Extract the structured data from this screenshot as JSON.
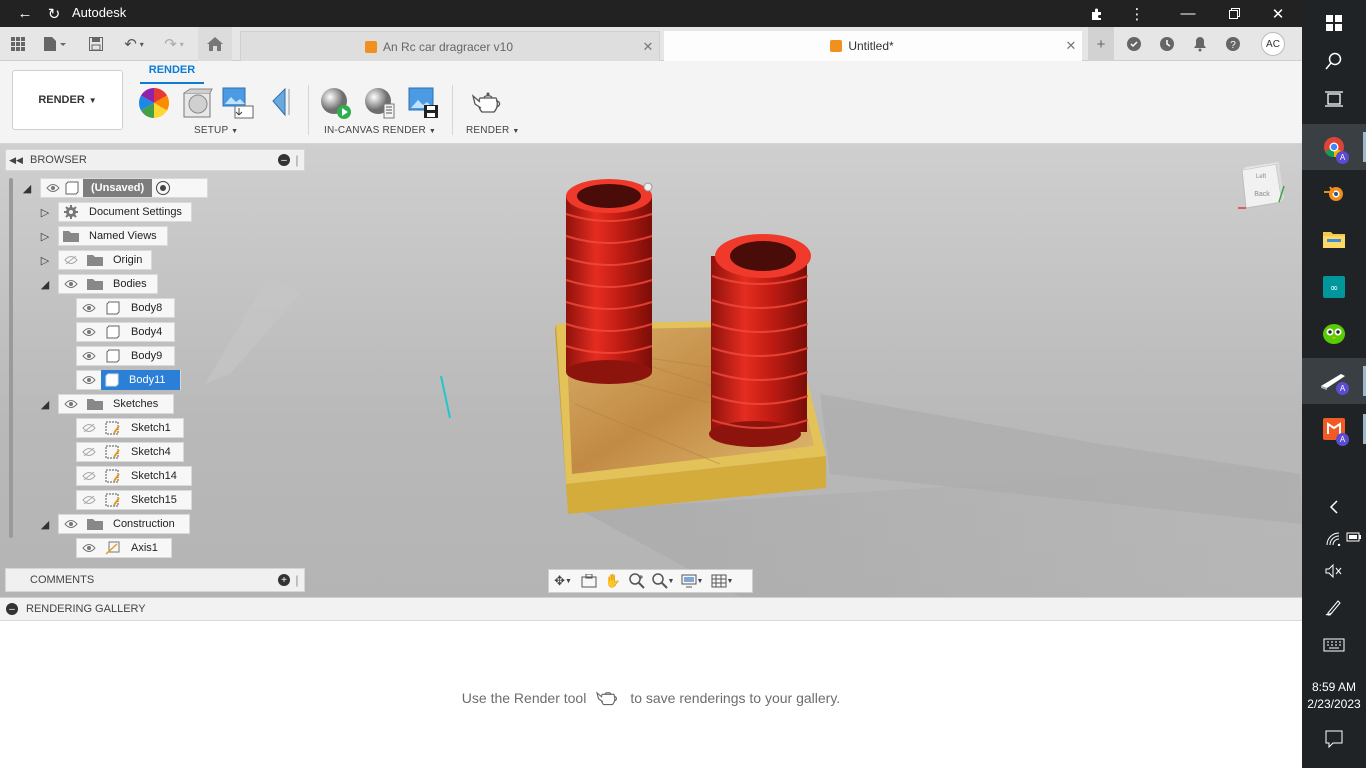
{
  "window": {
    "title": "Autodesk"
  },
  "tabs": [
    {
      "label": "An Rc car dragracer v10",
      "active": false
    },
    {
      "label": "Untitled*",
      "active": true
    }
  ],
  "user": {
    "initials": "AC"
  },
  "toolbar": {
    "workspace": "RENDER",
    "active_tab": "RENDER",
    "groups": [
      {
        "label": "SETUP"
      },
      {
        "label": "IN-CANVAS RENDER"
      },
      {
        "label": "RENDER"
      }
    ]
  },
  "browser": {
    "title": "BROWSER",
    "items": [
      {
        "label": "(Unsaved)"
      },
      {
        "label": "Document Settings"
      },
      {
        "label": "Named Views"
      },
      {
        "label": "Origin"
      },
      {
        "label": "Bodies"
      },
      {
        "label": "Body8"
      },
      {
        "label": "Body4"
      },
      {
        "label": "Body9"
      },
      {
        "label": "Body11"
      },
      {
        "label": "Sketches"
      },
      {
        "label": "Sketch1"
      },
      {
        "label": "Sketch4"
      },
      {
        "label": "Sketch14"
      },
      {
        "label": "Sketch15"
      },
      {
        "label": "Construction"
      },
      {
        "label": "Axis1"
      }
    ]
  },
  "comments": {
    "title": "COMMENTS"
  },
  "viewcube": {
    "faces": [
      "Left",
      "Back"
    ]
  },
  "gallery": {
    "title": "RENDERING GALLERY",
    "message_prefix": "Use the Render tool",
    "message_suffix": "to save renderings to your gallery."
  },
  "taskbar": {
    "time": "8:59 AM",
    "date": "2/23/2023",
    "badge": "A"
  },
  "colors": {
    "accent": "#0b7bd5",
    "selection": "#2c7fd6",
    "cylinder": "#d9261c",
    "wood": "#c99a55",
    "tray": "#e3c25a"
  }
}
